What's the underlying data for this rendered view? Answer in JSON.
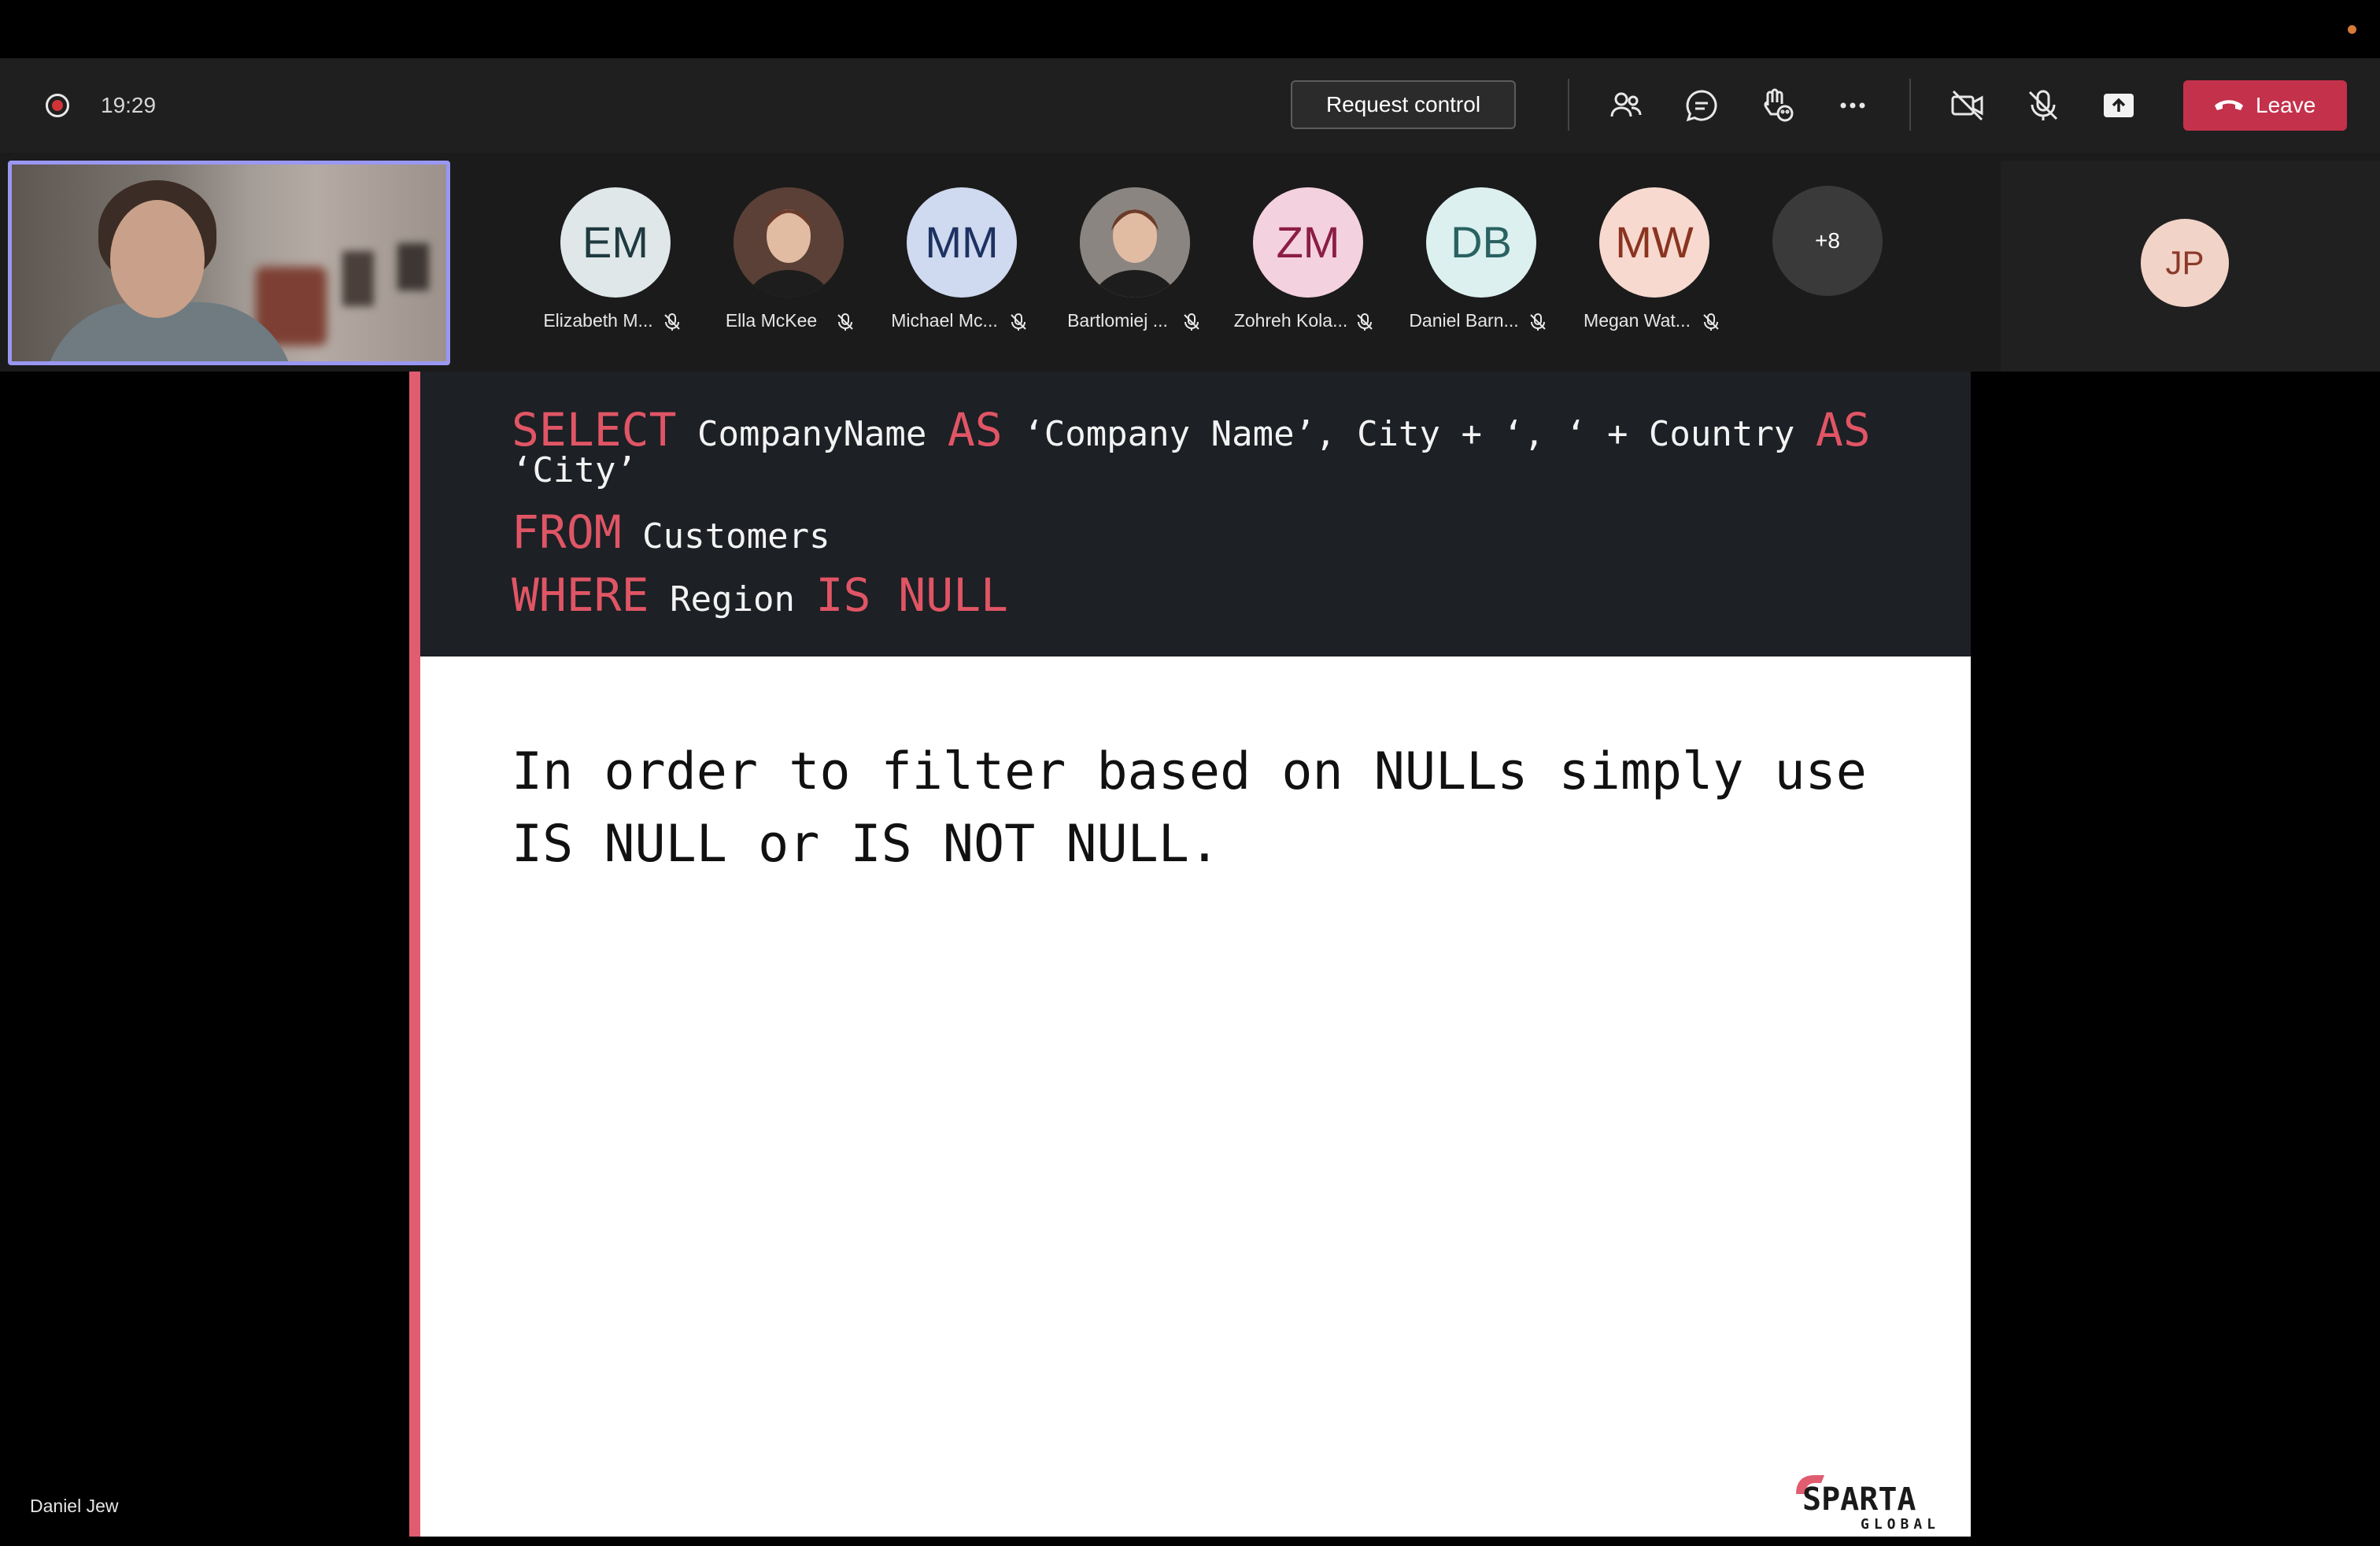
{
  "meeting": {
    "timer": "19:29",
    "request_control_label": "Request control",
    "leave_label": "Leave",
    "presenter_name": "Daniel Jew"
  },
  "toolbar_icons": [
    "participants-icon",
    "chat-icon",
    "reactions-icon",
    "more-options-icon",
    "camera-off-icon",
    "mic-off-icon",
    "share-tray-icon"
  ],
  "participants": [
    {
      "initials": "EM",
      "name": "Elizabeth M...",
      "bg": "#dfe7e8",
      "fg": "#1f3a40",
      "photo": false
    },
    {
      "initials": "",
      "name": "Ella McKee",
      "bg": "#5a4036",
      "fg": "#fff",
      "photo": true
    },
    {
      "initials": "MM",
      "name": "Michael Mc...",
      "bg": "#cfd9ef",
      "fg": "#1d3262",
      "photo": false
    },
    {
      "initials": "",
      "name": "Bartlomiej ...",
      "bg": "#8a8580",
      "fg": "#fff",
      "photo": true
    },
    {
      "initials": "ZM",
      "name": "Zohreh Kola...",
      "bg": "#f4d1de",
      "fg": "#8b1d44",
      "photo": false
    },
    {
      "initials": "DB",
      "name": "Daniel Barn...",
      "bg": "#dcf0f0",
      "fg": "#2a6161",
      "photo": false
    },
    {
      "initials": "MW",
      "name": "Megan Wat...",
      "bg": "#f7d9cf",
      "fg": "#8a3420",
      "photo": false
    }
  ],
  "overflow_count": "+8",
  "pinned_avatar": {
    "initials": "JP"
  },
  "slide": {
    "code": {
      "line1": {
        "kw1": "SELECT",
        "t1": " CompanyName ",
        "kw2": "AS",
        "t2": " ‘Company Name’, City + ‘, ‘ + Country ",
        "kw3": "AS"
      },
      "line1b": "‘City’",
      "line2": {
        "kw": "FROM",
        "t": " Customers"
      },
      "line3": {
        "kw1": "WHERE",
        "t": " Region ",
        "kw2": "IS NULL"
      }
    },
    "body_line1": "In order to filter based on NULLs simply use",
    "body_line2": "IS NULL or IS NOT NULL.",
    "logo_top": "SPARTA",
    "logo_bottom": "GLOBAL"
  },
  "colors": {
    "accent": "#e05c6f",
    "leave": "#c4314b",
    "selfview_border": "#9a97f2"
  }
}
